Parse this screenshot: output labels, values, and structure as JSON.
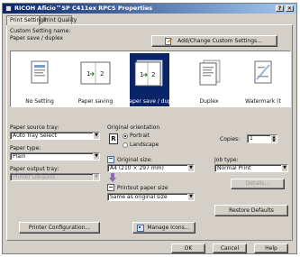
{
  "window": {
    "title": "RICOH Aficio™SP C411ex RPCS Properties",
    "help_button": "?",
    "close_button": "✕"
  },
  "tabs": [
    {
      "label": "Print Settings",
      "active": true
    },
    {
      "label": "Print Quality",
      "active": false
    }
  ],
  "custom_setting": {
    "label": "Custom Setting name:",
    "value": "Paper save / duplex",
    "add_change_button": "Add/Change Custom Settings..."
  },
  "presets": [
    {
      "label": "No Setting",
      "icon": "no-setting-icon"
    },
    {
      "label": "Paper saving",
      "icon": "paper-saving-icon"
    },
    {
      "label": "Paper save / duplex",
      "icon": "paper-save-duplex-icon",
      "selected": true
    },
    {
      "label": "Duplex",
      "icon": "duplex-icon"
    },
    {
      "label": "Watermark (t",
      "icon": "watermark-icon"
    }
  ],
  "paper_source": {
    "label": "Paper source tray:",
    "value": "Auto Tray Select"
  },
  "paper_type": {
    "label": "Paper type:",
    "value": "Plain"
  },
  "paper_output": {
    "label": "Paper output tray:",
    "value": "Printer Defaults"
  },
  "orientation": {
    "label": "Original orientation",
    "icon_letter": "R",
    "portrait": "Portrait",
    "landscape": "Landscape",
    "selected": "Portrait"
  },
  "copies": {
    "label": "Copies:",
    "value": "1"
  },
  "original_size": {
    "label": "Original size:",
    "value": "A4 (210 × 297 mm)"
  },
  "printout_size": {
    "label": "Printout paper size",
    "value": "Same as original size"
  },
  "job_type": {
    "label": "Job type:",
    "value": "Normal Print",
    "details_button": "Details..."
  },
  "buttons": {
    "printer_config": "Printer Configuration...",
    "manage_icons": "Manage Icons...",
    "restore_defaults": "Restore Defaults",
    "ok": "OK",
    "cancel": "Cancel",
    "help": "Help"
  },
  "colors": {
    "title_bar": "#0a246a",
    "selection": "#0a246a",
    "face": "#d4d0c8"
  }
}
